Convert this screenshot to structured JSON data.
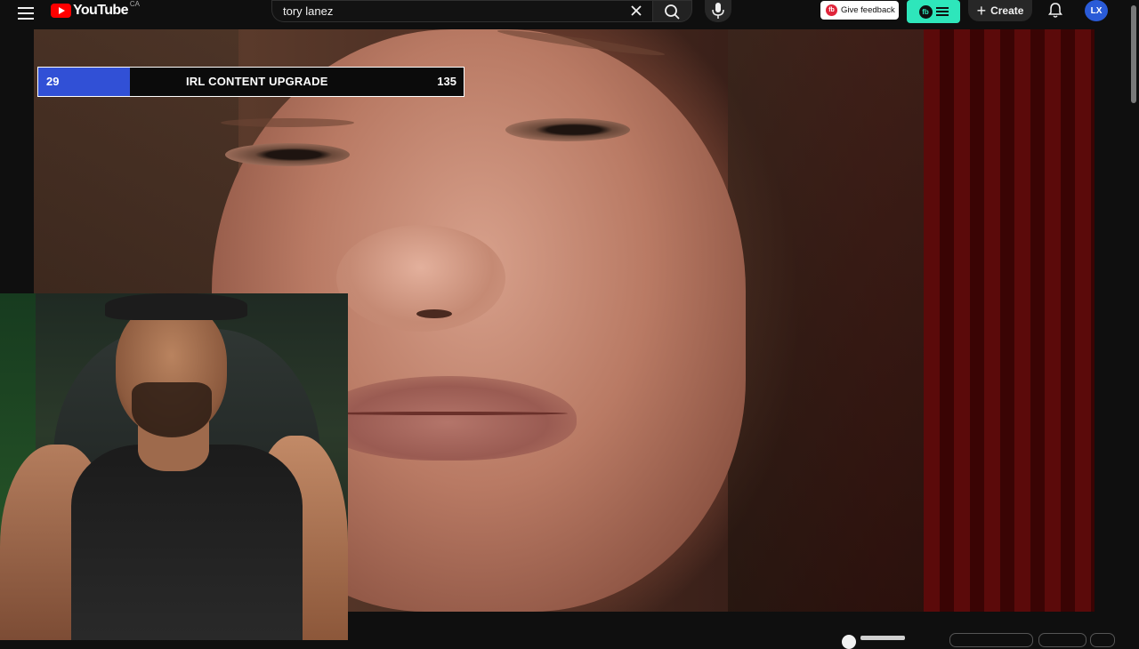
{
  "header": {
    "logo_text": "YouTube",
    "country_code": "CA",
    "search": {
      "value": "tory lanez",
      "placeholder": "Search"
    },
    "feedback_label": "Give feedback",
    "feedback_badge": "fb",
    "extension_badge": "fb",
    "create_label": "Create",
    "avatar_initials": "LX",
    "icons": [
      "menu-icon",
      "youtube-logo-icon",
      "clear-icon",
      "search-icon",
      "mic-icon",
      "plus-icon",
      "bell-icon"
    ]
  },
  "overlay": {
    "goal_current": "29",
    "goal_title": "IRL CONTENT UPGRADE",
    "goal_target": "135",
    "goal_progress": 0.215,
    "accent": "#3150d6"
  },
  "colors": {
    "background": "#0f0f0f",
    "brand_red": "#ff0000",
    "extension_accent": "#2ee6bb"
  }
}
